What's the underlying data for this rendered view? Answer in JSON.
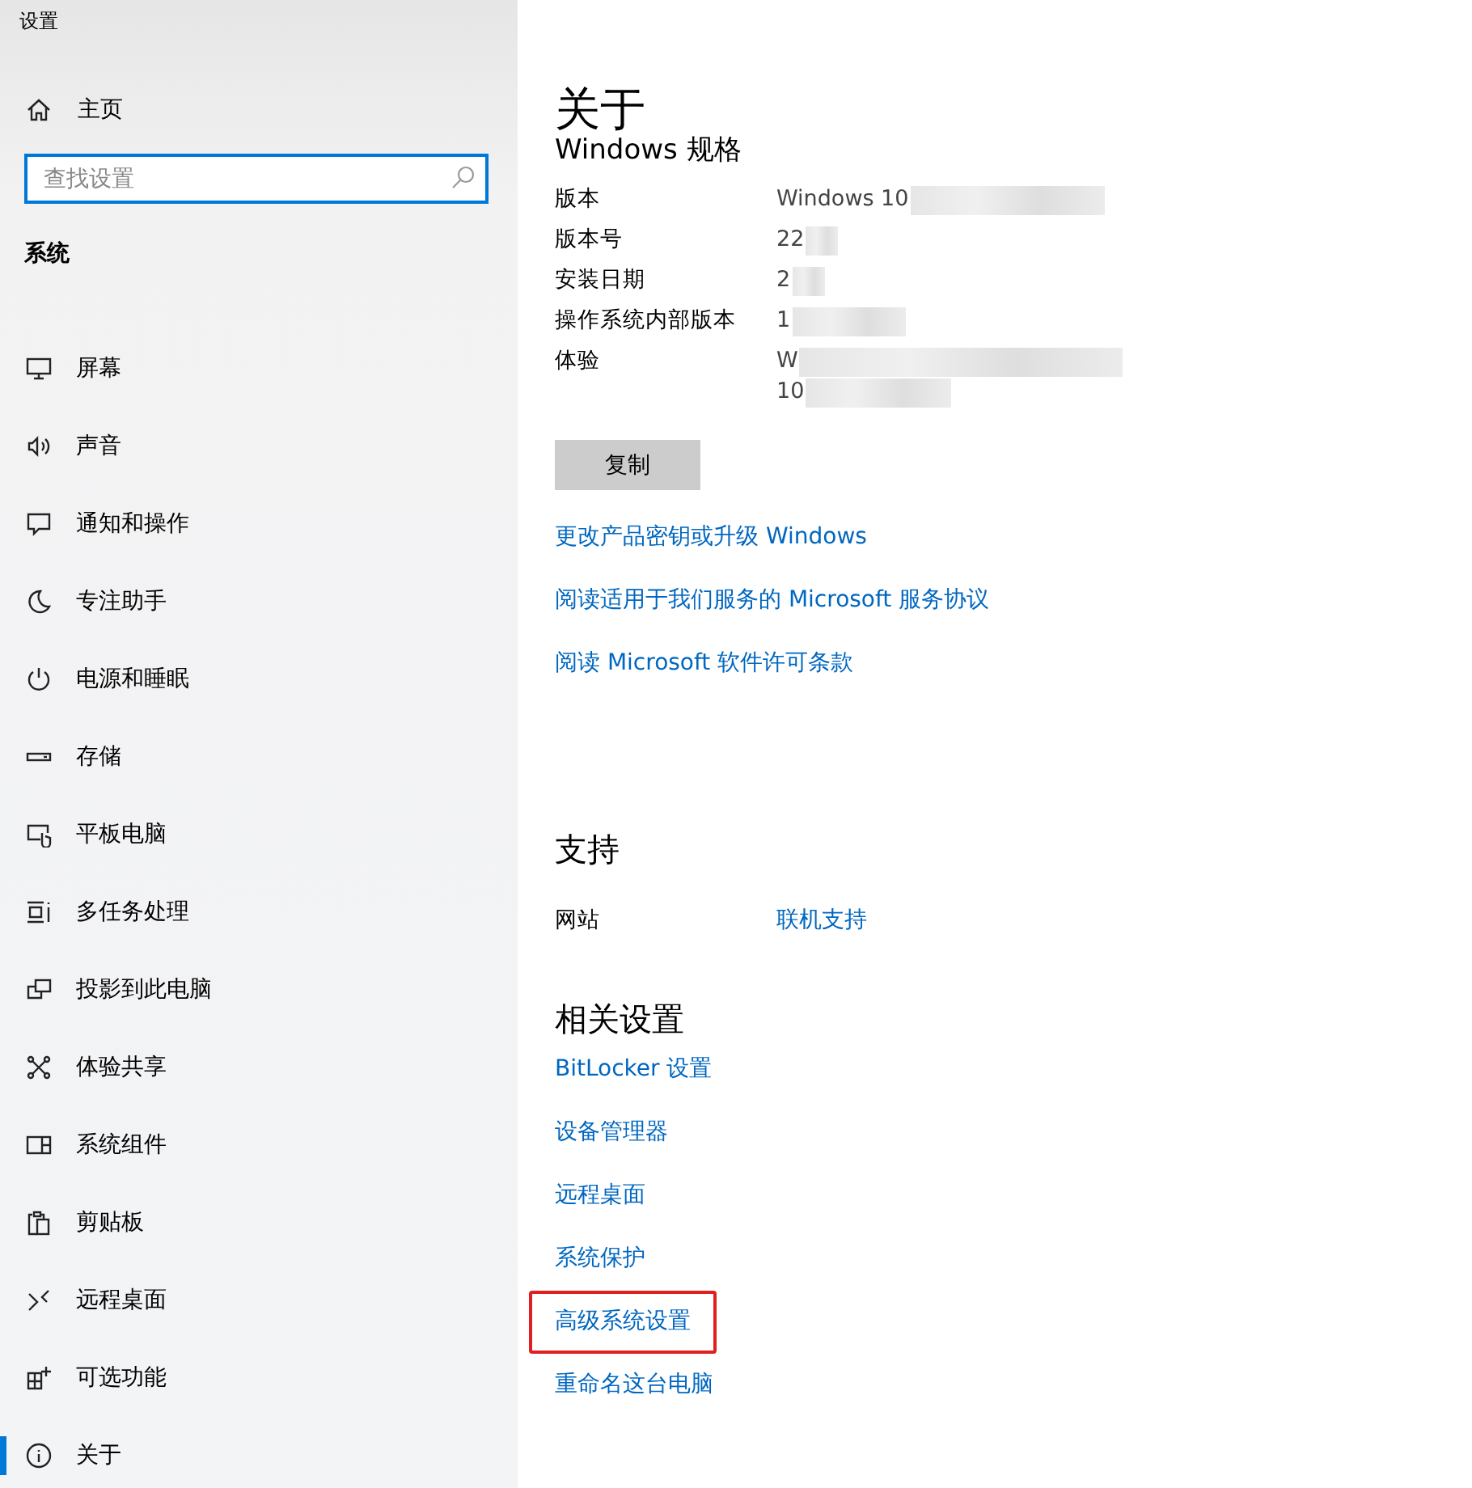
{
  "window": {
    "title": "设置"
  },
  "sidebar": {
    "home": "主页",
    "search": {
      "placeholder": "查找设置"
    },
    "section": "系统",
    "items": [
      {
        "label": "屏幕",
        "selected": false
      },
      {
        "label": "声音",
        "selected": false
      },
      {
        "label": "通知和操作",
        "selected": false
      },
      {
        "label": "专注助手",
        "selected": false
      },
      {
        "label": "电源和睡眠",
        "selected": false
      },
      {
        "label": "存储",
        "selected": false
      },
      {
        "label": "平板电脑",
        "selected": false
      },
      {
        "label": "多任务处理",
        "selected": false
      },
      {
        "label": "投影到此电脑",
        "selected": false
      },
      {
        "label": "体验共享",
        "selected": false
      },
      {
        "label": "系统组件",
        "selected": false
      },
      {
        "label": "剪贴板",
        "selected": false
      },
      {
        "label": "远程桌面",
        "selected": false
      },
      {
        "label": "可选功能",
        "selected": false
      },
      {
        "label": "关于",
        "selected": true
      }
    ]
  },
  "page": {
    "title": "关于",
    "specs": {
      "heading": "Windows 规格",
      "rows": [
        {
          "label": "版本",
          "value": [
            "Windows 10"
          ],
          "blurred": true
        },
        {
          "label": "版本号",
          "value": [
            "22"
          ],
          "blurred": true
        },
        {
          "label": "安装日期",
          "value": [
            "2"
          ],
          "blurred": true
        },
        {
          "label": "操作系统内部版本",
          "value": [
            "1"
          ],
          "blurred": true
        },
        {
          "label": "体验",
          "value": [
            "W",
            "10"
          ],
          "blurred": true
        }
      ],
      "copy_button": "复制",
      "links": [
        "更改产品密钥或升级 Windows",
        "阅读适用于我们服务的 Microsoft 服务协议",
        "阅读 Microsoft 软件许可条款"
      ]
    },
    "support": {
      "heading": "支持",
      "label": "网站",
      "link": "联机支持"
    },
    "related": {
      "heading": "相关设置",
      "links": [
        {
          "label": "BitLocker 设置",
          "highlighted": false
        },
        {
          "label": "设备管理器",
          "highlighted": false
        },
        {
          "label": "远程桌面",
          "highlighted": false
        },
        {
          "label": "系统保护",
          "highlighted": false
        },
        {
          "label": "高级系统设置",
          "highlighted": true
        },
        {
          "label": "重命名这台电脑",
          "highlighted": false
        }
      ]
    }
  }
}
